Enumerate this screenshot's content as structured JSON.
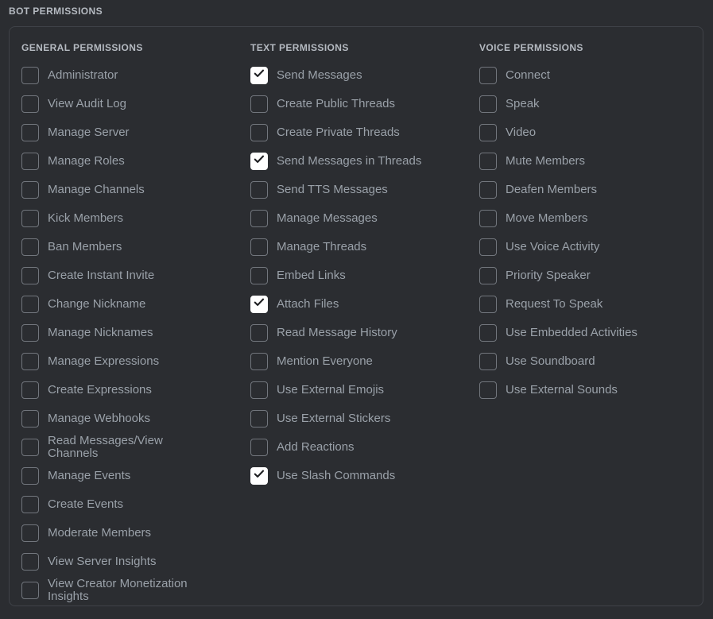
{
  "section": {
    "title": "BOT PERMISSIONS"
  },
  "colors": {
    "background": "#2b2d31",
    "panel_border": "#3f4248",
    "label_text": "#9aa1a9",
    "heading_text": "#b5bac1",
    "checkbox_border": "#72767d",
    "checkbox_checked_bg": "#ffffff",
    "checkmark": "#1e1f22"
  },
  "columns": [
    {
      "id": "general",
      "title": "GENERAL PERMISSIONS",
      "items": [
        {
          "label": "Administrator",
          "checked": false
        },
        {
          "label": "View Audit Log",
          "checked": false
        },
        {
          "label": "Manage Server",
          "checked": false
        },
        {
          "label": "Manage Roles",
          "checked": false
        },
        {
          "label": "Manage Channels",
          "checked": false
        },
        {
          "label": "Kick Members",
          "checked": false
        },
        {
          "label": "Ban Members",
          "checked": false
        },
        {
          "label": "Create Instant Invite",
          "checked": false
        },
        {
          "label": "Change Nickname",
          "checked": false
        },
        {
          "label": "Manage Nicknames",
          "checked": false
        },
        {
          "label": "Manage Expressions",
          "checked": false
        },
        {
          "label": "Create Expressions",
          "checked": false
        },
        {
          "label": "Manage Webhooks",
          "checked": false
        },
        {
          "label": "Read Messages/View Channels",
          "checked": false
        },
        {
          "label": "Manage Events",
          "checked": false
        },
        {
          "label": "Create Events",
          "checked": false
        },
        {
          "label": "Moderate Members",
          "checked": false
        },
        {
          "label": "View Server Insights",
          "checked": false
        },
        {
          "label": "View Creator Monetization Insights",
          "checked": false
        }
      ]
    },
    {
      "id": "text",
      "title": "TEXT PERMISSIONS",
      "items": [
        {
          "label": "Send Messages",
          "checked": true
        },
        {
          "label": "Create Public Threads",
          "checked": false
        },
        {
          "label": "Create Private Threads",
          "checked": false
        },
        {
          "label": "Send Messages in Threads",
          "checked": true
        },
        {
          "label": "Send TTS Messages",
          "checked": false
        },
        {
          "label": "Manage Messages",
          "checked": false
        },
        {
          "label": "Manage Threads",
          "checked": false
        },
        {
          "label": "Embed Links",
          "checked": false
        },
        {
          "label": "Attach Files",
          "checked": true
        },
        {
          "label": "Read Message History",
          "checked": false
        },
        {
          "label": "Mention Everyone",
          "checked": false
        },
        {
          "label": "Use External Emojis",
          "checked": false
        },
        {
          "label": "Use External Stickers",
          "checked": false
        },
        {
          "label": "Add Reactions",
          "checked": false
        },
        {
          "label": "Use Slash Commands",
          "checked": true
        }
      ]
    },
    {
      "id": "voice",
      "title": "VOICE PERMISSIONS",
      "items": [
        {
          "label": "Connect",
          "checked": false
        },
        {
          "label": "Speak",
          "checked": false
        },
        {
          "label": "Video",
          "checked": false
        },
        {
          "label": "Mute Members",
          "checked": false
        },
        {
          "label": "Deafen Members",
          "checked": false
        },
        {
          "label": "Move Members",
          "checked": false
        },
        {
          "label": "Use Voice Activity",
          "checked": false
        },
        {
          "label": "Priority Speaker",
          "checked": false
        },
        {
          "label": "Request To Speak",
          "checked": false
        },
        {
          "label": "Use Embedded Activities",
          "checked": false
        },
        {
          "label": "Use Soundboard",
          "checked": false
        },
        {
          "label": "Use External Sounds",
          "checked": false
        }
      ]
    }
  ]
}
